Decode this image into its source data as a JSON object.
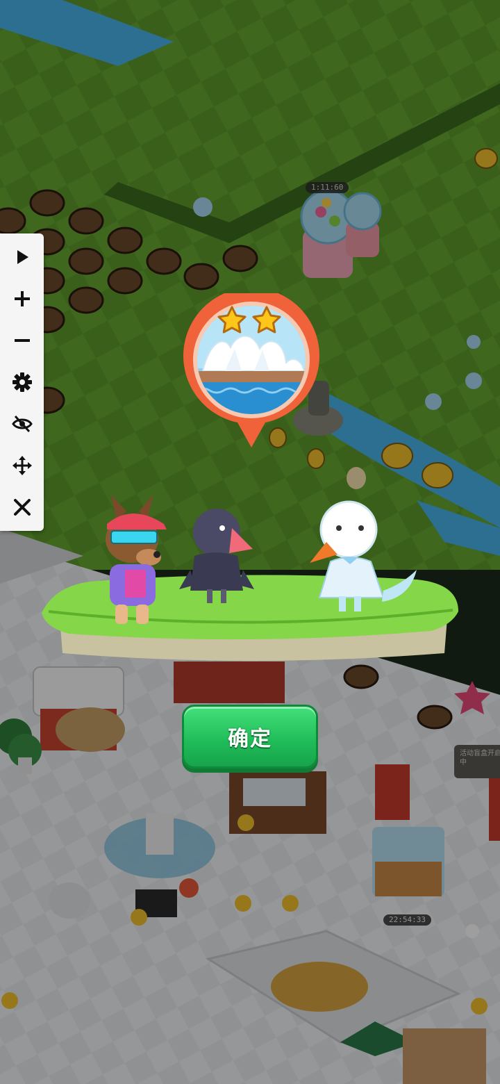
{
  "world": {
    "timers": [
      "1:11:60",
      "22:54:33"
    ],
    "event_banner": "活动盲盒开启中"
  },
  "toolbar": {
    "items": [
      {
        "icon": "play-icon",
        "name": "play"
      },
      {
        "icon": "zoom-in-icon",
        "name": "zoom-in"
      },
      {
        "icon": "zoom-out-icon",
        "name": "zoom-out"
      },
      {
        "icon": "gear-icon",
        "name": "settings"
      },
      {
        "icon": "eye-off-icon",
        "name": "hide"
      },
      {
        "icon": "move-icon",
        "name": "move"
      },
      {
        "icon": "close-icon",
        "name": "close"
      }
    ]
  },
  "reward": {
    "stars": 2,
    "location_icon": "sydney-opera-house-icon",
    "characters": [
      "dog-character",
      "crow-character",
      "swan-character"
    ],
    "confirm_label": "确定"
  },
  "colors": {
    "confirm": "#1fbb58",
    "pin_ring": "#f0633a",
    "star": "#ffc61a"
  }
}
